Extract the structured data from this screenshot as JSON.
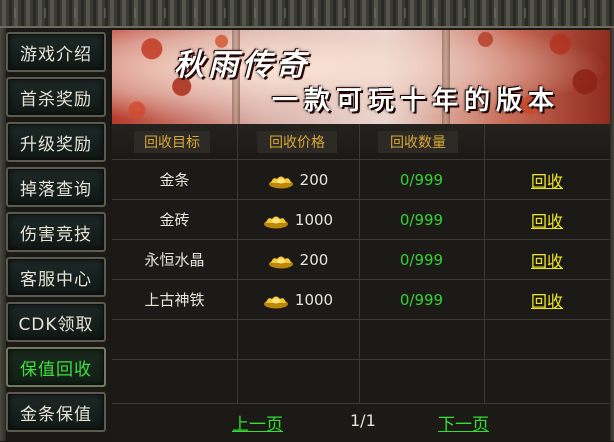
{
  "sidebar": {
    "items": [
      {
        "label": "游戏介绍",
        "active": false
      },
      {
        "label": "首杀奖励",
        "active": false
      },
      {
        "label": "升级奖励",
        "active": false
      },
      {
        "label": "掉落查询",
        "active": false
      },
      {
        "label": "伤害竞技",
        "active": false
      },
      {
        "label": "客服中心",
        "active": false
      },
      {
        "label": "CDK领取",
        "active": false
      },
      {
        "label": "保值回收",
        "active": true
      },
      {
        "label": "金条保值",
        "active": false
      }
    ]
  },
  "banner": {
    "title": "秋雨传奇",
    "slogan": "一款可玩十年的版本"
  },
  "table": {
    "headers": [
      "回收目标",
      "回收价格",
      "回收数量"
    ],
    "rows": [
      {
        "name": "金条",
        "price_icon": "gold-ingot-icon",
        "price": "200",
        "count": "0/999",
        "action": "回收"
      },
      {
        "name": "金砖",
        "price_icon": "gold-ingot-icon",
        "price": "1000",
        "count": "0/999",
        "action": "回收"
      },
      {
        "name": "永恒水晶",
        "price_icon": "gold-ingot-icon",
        "price": "200",
        "count": "0/999",
        "action": "回收"
      },
      {
        "name": "上古神铁",
        "price_icon": "gold-ingot-icon",
        "price": "1000",
        "count": "0/999",
        "action": "回收"
      }
    ]
  },
  "pagination": {
    "prev": "上一页",
    "page": "1/1",
    "next": "下一页"
  },
  "colors": {
    "accent_green": "#31e031",
    "header_gold": "#d8a838",
    "action_yellow": "#f2e81e",
    "count_green": "#36d136"
  }
}
